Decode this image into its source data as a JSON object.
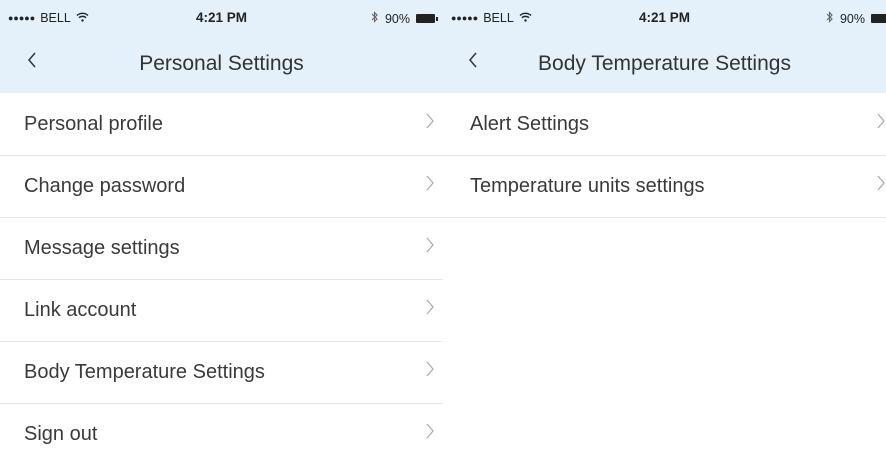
{
  "left_screen": {
    "status": {
      "signal_dots": "●●●●●",
      "carrier": "BELL",
      "time": "4:21 PM",
      "battery": "90%"
    },
    "title": "Personal Settings",
    "back_glyph": "<",
    "items": [
      {
        "label": "Personal profile"
      },
      {
        "label": "Change password"
      },
      {
        "label": "Message settings"
      },
      {
        "label": "Link account"
      },
      {
        "label": "Body Temperature Settings"
      },
      {
        "label": "Sign out"
      }
    ]
  },
  "right_screen": {
    "status": {
      "signal_dots": "●●●●●",
      "carrier": "BELL",
      "time": "4:21 PM",
      "battery": "90%"
    },
    "title": "Body Temperature Settings",
    "back_glyph": "<",
    "items": [
      {
        "label": "Alert Settings"
      },
      {
        "label": "Temperature units settings"
      }
    ]
  },
  "icons": {
    "back": "chevron-left-icon",
    "row": "chevron-right-icon",
    "wifi": "wifi-icon",
    "bluetooth": "bluetooth-icon",
    "battery": "battery-icon"
  },
  "colors": {
    "header_bg": "#e5f1fa",
    "divider": "#e6e6e6",
    "text": "#3a3a3a",
    "chevron": "#a8a8a8"
  }
}
